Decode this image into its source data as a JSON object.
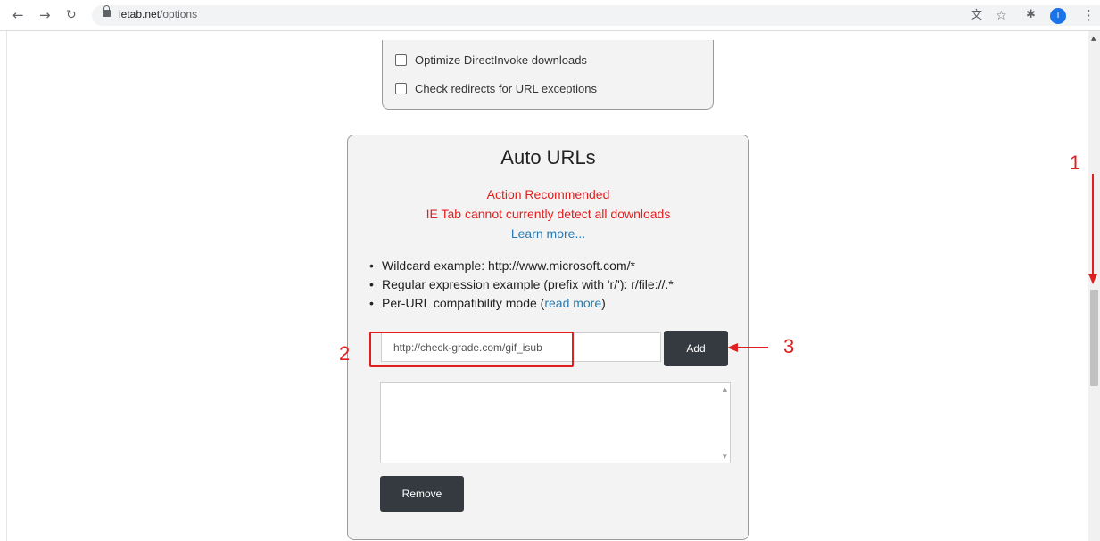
{
  "browser": {
    "url_host": "ietab.net",
    "url_path": "/options",
    "avatar_initial": "I",
    "icons": [
      "back-arrow-icon",
      "forward-arrow-icon",
      "reload-icon",
      "lock-icon",
      "translate-icon",
      "star-icon",
      "extensions-icon",
      "menu-kebab-icon"
    ]
  },
  "top_panel": {
    "options": [
      {
        "label": "Optimize DirectInvoke downloads",
        "checked": false
      },
      {
        "label": "Check redirects for URL exceptions",
        "checked": false
      }
    ]
  },
  "auto_urls": {
    "title": "Auto URLs",
    "warning_line1": "Action Recommended",
    "warning_line2": "IE Tab cannot currently detect all downloads",
    "learn_more": "Learn more...",
    "tips": {
      "wildcard": "Wildcard example: http://www.microsoft.com/*",
      "regex": "Regular expression example (prefix with 'r/'): r/file://.*",
      "per_url_prefix": "Per-URL compatibility mode (",
      "per_url_link": "read more",
      "per_url_suffix": ")"
    },
    "input_value": "http://check-grade.com/gif_isub",
    "add_label": "Add",
    "remove_label": "Remove",
    "url_list": []
  },
  "annotations": {
    "step1": "1",
    "step2": "2",
    "step3": "3",
    "color": "#e02020"
  },
  "colors": {
    "button_bg": "#343a40",
    "warning": "#e02020",
    "link": "#2a7ab0",
    "avatar": "#1a73e8"
  }
}
